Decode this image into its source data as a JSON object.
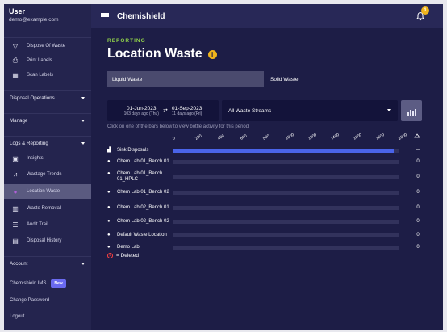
{
  "sidebar": {
    "user_name": "User",
    "user_email": "demo@example.com",
    "top_items": [
      {
        "label": "Dispose Of Waste",
        "icon": "funnel-icon"
      },
      {
        "label": "Print Labels",
        "icon": "printer-icon"
      },
      {
        "label": "Scan Labels",
        "icon": "qr-icon"
      }
    ],
    "sections": {
      "disposal": "Disposal Operations",
      "manage": "Manage",
      "logs": "Logs & Reporting",
      "account": "Account"
    },
    "log_items": [
      {
        "label": "Insights",
        "icon": "insights-icon",
        "active": false
      },
      {
        "label": "Wastage Trends",
        "icon": "trend-icon",
        "active": false
      },
      {
        "label": "Location Waste",
        "icon": "location-icon",
        "active": true
      },
      {
        "label": "Waste Removal",
        "icon": "bin-icon",
        "active": false
      },
      {
        "label": "Audit Trail",
        "icon": "list-icon",
        "active": false
      },
      {
        "label": "Disposal History",
        "icon": "document-icon",
        "active": false
      }
    ],
    "account_items": {
      "ims_label": "Chemishield IMS",
      "new_badge": "New",
      "change_password": "Change Password",
      "logout": "Logout"
    }
  },
  "topbar": {
    "title": "Chemishield",
    "notification_count": "1"
  },
  "header": {
    "section": "REPORTING",
    "title": "Location Waste"
  },
  "tabs": {
    "liquid": "Liquid Waste",
    "solid": "Solid Waste"
  },
  "filters": {
    "start_date": "01-Jun-2023",
    "start_sub": "103 days ago (Thu)",
    "end_date": "01-Sep-2023",
    "end_sub": "11 days ago (Fri)",
    "stream": "All Waste Streams"
  },
  "hint": "Click on one of the bars below to view bottle activity for this period",
  "chart_data": {
    "type": "bar",
    "orientation": "horizontal",
    "axis_ticks": [
      "0",
      "200",
      "400",
      "600",
      "800",
      "1000",
      "1200",
      "1400",
      "1600",
      "1800",
      "2000"
    ],
    "xlim": [
      0,
      2000
    ],
    "categories": [
      "Sink Disposals",
      "Chem Lab 01_Bench 01",
      "Chem Lab 01_Bench 01_HPLC",
      "Chem Lab 01_Bench 02",
      "Chem Lab 02_Bench 01",
      "Chem Lab 02_Bench 02",
      "Default Waste Location",
      "Demo Lab"
    ],
    "values": [
      1950,
      0,
      0,
      0,
      0,
      0,
      0,
      0
    ],
    "value_labels": [
      "—",
      "0",
      "0",
      "0",
      "0",
      "0",
      "0",
      "0"
    ],
    "bar_color": "#4a64ea",
    "track_color": "#32325c"
  },
  "legend": {
    "deleted": "= Deleted"
  }
}
